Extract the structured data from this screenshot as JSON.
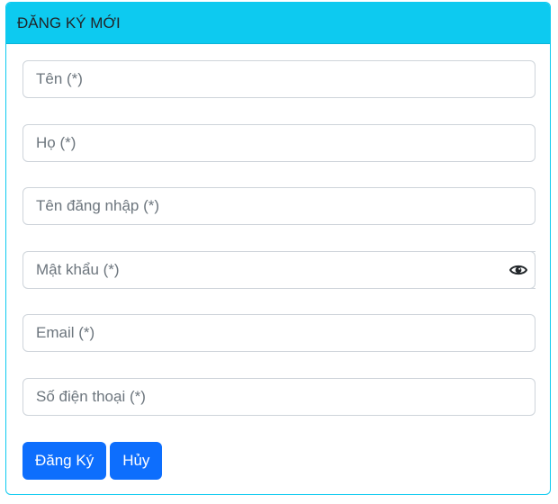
{
  "header": {
    "title": "ĐĂNG KÝ MỚI"
  },
  "form": {
    "first_name": {
      "placeholder": "Tên (*)",
      "value": ""
    },
    "last_name": {
      "placeholder": "Họ (*)",
      "value": ""
    },
    "username": {
      "placeholder": "Tên đăng nhập (*)",
      "value": ""
    },
    "password": {
      "placeholder": "Mật khẩu (*)",
      "value": "",
      "toggle_icon": "eye-icon"
    },
    "email": {
      "placeholder": "Email (*)",
      "value": ""
    },
    "phone": {
      "placeholder": "Số điện thoại (*)",
      "value": ""
    }
  },
  "actions": {
    "submit_label": "Đăng Ký",
    "cancel_label": "Hủy"
  },
  "colors": {
    "header_bg": "#0dcaf0",
    "primary": "#0d6efd",
    "border": "#ced4da",
    "placeholder": "#6c757d"
  }
}
